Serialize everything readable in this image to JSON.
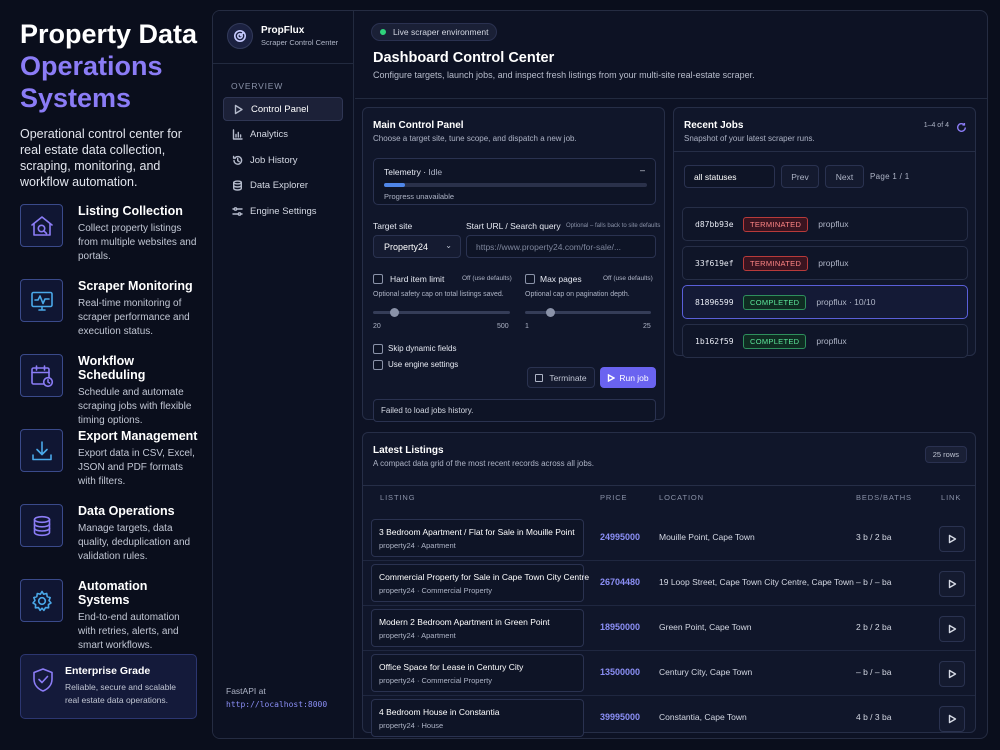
{
  "promo": {
    "title_line1": "Property Data",
    "title_accent": "Operations Systems",
    "intro": "Operational control center for real estate data collection, scraping, monitoring, and workflow automation.",
    "features": [
      {
        "title": "Listing Collection",
        "desc": "Collect property listings from multiple websites and portals.",
        "icon": "house-search-icon"
      },
      {
        "title": "Scraper Monitoring",
        "desc": "Real-time monitoring of scraper performance and execution status.",
        "icon": "monitor-pulse-icon"
      },
      {
        "title": "Workflow Scheduling",
        "desc": "Schedule and automate scraping jobs with flexible timing options.",
        "icon": "calendar-clock-icon"
      },
      {
        "title": "Export Management",
        "desc": "Export data in CSV, Excel, JSON and PDF formats with filters.",
        "icon": "download-icon"
      },
      {
        "title": "Data Operations",
        "desc": "Manage targets, data quality, deduplication and validation rules.",
        "icon": "database-icon"
      },
      {
        "title": "Automation Systems",
        "desc": "End-to-end automation with retries, alerts, and smart workflows.",
        "icon": "gear-icon"
      }
    ],
    "enterprise": {
      "title": "Enterprise Grade",
      "desc": "Reliable, secure and scalable real estate data operations.",
      "icon": "shield-check-icon"
    }
  },
  "brand": {
    "name": "PropFlux",
    "subtitle": "Scraper Control Center"
  },
  "nav": {
    "heading": "OVERVIEW",
    "items": [
      {
        "label": "Control Panel",
        "icon": "play-icon",
        "active": true
      },
      {
        "label": "Analytics",
        "icon": "bar-chart-icon",
        "active": false
      },
      {
        "label": "Job History",
        "icon": "history-icon",
        "active": false
      },
      {
        "label": "Data Explorer",
        "icon": "database-icon",
        "active": false
      },
      {
        "label": "Engine Settings",
        "icon": "sliders-icon",
        "active": false
      }
    ]
  },
  "api": {
    "label": "FastAPI at",
    "url": "http://localhost:8000"
  },
  "header": {
    "env": "Live scraper environment",
    "title": "Dashboard Control Center",
    "subtitle": "Configure targets, launch jobs, and inspect fresh listings from your multi-site real-estate scraper."
  },
  "control": {
    "title": "Main Control Panel",
    "subtitle": "Choose a target site, tune scope, and dispatch a new job.",
    "telemetry": {
      "label": "Telemetry",
      "state": "Idle",
      "collapse": "–",
      "progress": 0.08,
      "progress_text": "Progress unavailable"
    },
    "target_label": "Target site",
    "target_value": "Property24",
    "query_label": "Start URL / Search query",
    "query_note": "Optional – falls back to site defaults",
    "query_placeholder": "https://www.property24.com/for-sale/...",
    "hard_limit": {
      "label": "Hard item limit",
      "aux": "Off (use defaults)",
      "hint": "Optional safety cap on total listings saved.",
      "min": "20",
      "max": "500",
      "value": 0.15
    },
    "max_pages": {
      "label": "Max pages",
      "aux": "Off (use defaults)",
      "hint": "Optional cap on pagination depth.",
      "min": "1",
      "max": "25",
      "value": 0.2
    },
    "skip_dynamic": "Skip dynamic fields",
    "use_engine": "Use engine settings",
    "terminate": "Terminate",
    "run": "Run job",
    "error": "Failed to load jobs history."
  },
  "jobs": {
    "title": "Recent Jobs",
    "subtitle": "Snapshot of your latest scraper runs.",
    "count": "1–4 of 4",
    "filter": "all statuses",
    "prev": "Prev",
    "next": "Next",
    "page": "Page 1 / 1",
    "rows": [
      {
        "id": "d87bb93e",
        "status": "TERMINATED",
        "source": "propflux",
        "kind": "term",
        "selected": false
      },
      {
        "id": "33f619ef",
        "status": "TERMINATED",
        "source": "propflux",
        "kind": "term",
        "selected": false
      },
      {
        "id": "81896599",
        "status": "COMPLETED",
        "source": "propflux · 10/10",
        "kind": "done",
        "selected": true
      },
      {
        "id": "1b162f59",
        "status": "COMPLETED",
        "source": "propflux",
        "kind": "done",
        "selected": false
      }
    ]
  },
  "listings": {
    "title": "Latest Listings",
    "subtitle": "A compact data grid of the most recent records across all jobs.",
    "rows_pill": "25 rows",
    "columns": {
      "listing": "LISTING",
      "price": "PRICE",
      "location": "LOCATION",
      "beds": "BEDS/BATHS",
      "link": "LINK"
    },
    "rows": [
      {
        "title": "3 Bedroom Apartment / Flat for Sale in Mouille Point",
        "meta": "property24 · Apartment",
        "price": "24995000",
        "location": "Mouille Point, Cape Town",
        "beds": "3 b / 2 ba"
      },
      {
        "title": "Commercial Property for Sale in Cape Town City Centre",
        "meta": "property24 · Commercial Property",
        "price": "26704480",
        "location": "19 Loop Street, Cape Town City Centre, Cape Town",
        "beds": "– b / – ba"
      },
      {
        "title": "Modern 2 Bedroom Apartment in Green Point",
        "meta": "property24 · Apartment",
        "price": "18950000",
        "location": "Green Point, Cape Town",
        "beds": "2 b / 2 ba"
      },
      {
        "title": "Office Space for Lease in Century City",
        "meta": "property24 · Commercial Property",
        "price": "13500000",
        "location": "Century City, Cape Town",
        "beds": "– b / – ba"
      },
      {
        "title": "4 Bedroom House in Constantia",
        "meta": "property24 · House",
        "price": "39995000",
        "location": "Constantia, Cape Town",
        "beds": "4 b / 3 ba"
      }
    ]
  }
}
